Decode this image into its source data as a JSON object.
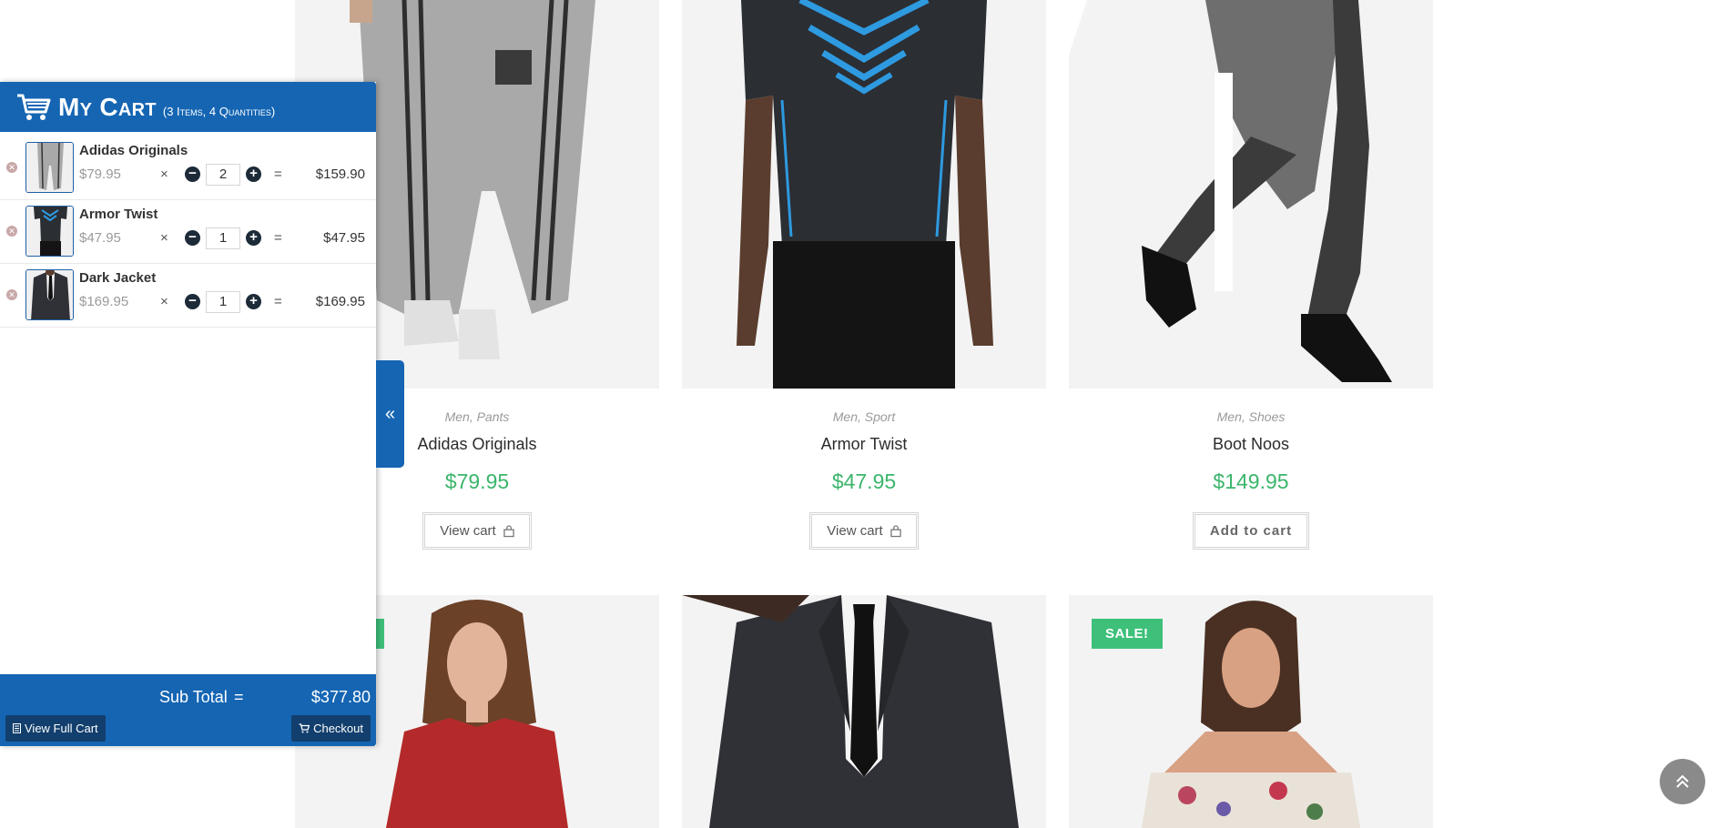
{
  "products": [
    {
      "meta": "Men, Pants",
      "title": "Adidas Originals",
      "price": "$79.95",
      "button": "View cart"
    },
    {
      "meta": "Men, Sport",
      "title": "Armor Twist",
      "price": "$47.95",
      "button": "View cart"
    },
    {
      "meta": "Men, Shoes",
      "title": "Boot Noos",
      "price": "$149.95",
      "button": "Add to cart"
    }
  ],
  "sale_badge": "SALE!",
  "cart": {
    "title": "My Cart",
    "count": "(3 Items, 4 Quantities)",
    "items": [
      {
        "name": "Adidas Originals",
        "unit_price": "$79.95",
        "times": "×",
        "qty": "2",
        "equals": "=",
        "total": "$159.90"
      },
      {
        "name": "Armor Twist",
        "unit_price": "$47.95",
        "times": "×",
        "qty": "1",
        "equals": "=",
        "total": "$47.95"
      },
      {
        "name": "Dark Jacket",
        "unit_price": "$169.95",
        "times": "×",
        "qty": "1",
        "equals": "=",
        "total": "$169.95"
      }
    ],
    "subtotal_label": "Sub Total",
    "subtotal_equals": "=",
    "subtotal_value": "$377.80",
    "view_full_cart": "View Full Cart",
    "checkout": "Checkout",
    "toggle_glyph": "«"
  },
  "back_to_top_glyph": "⌃",
  "colors": {
    "accent": "#1565b3",
    "price": "#3bb56b",
    "sale": "#3ec07a"
  }
}
